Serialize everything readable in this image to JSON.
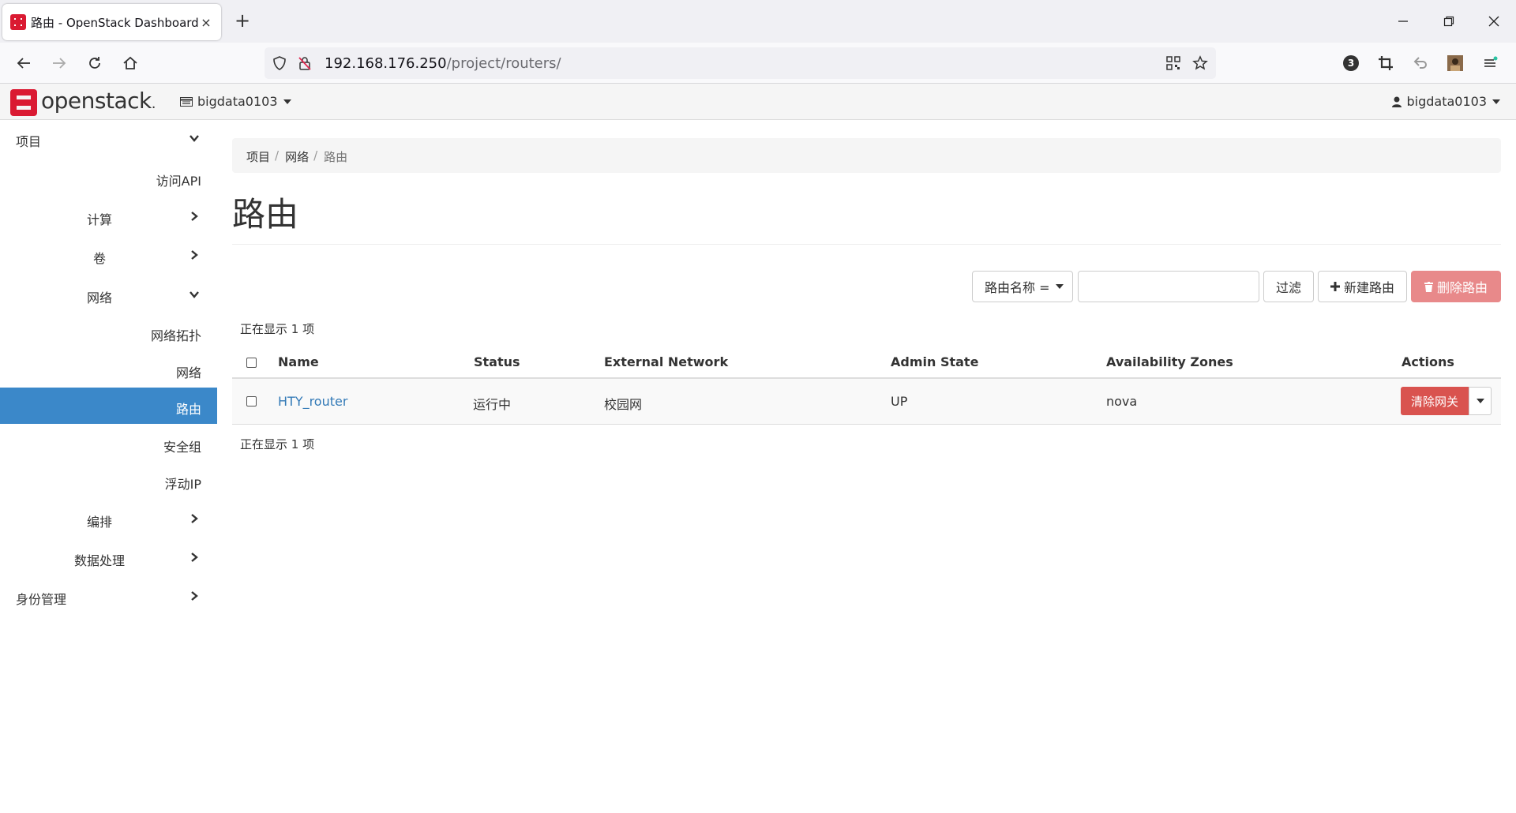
{
  "browser": {
    "tab_title": "路由 - OpenStack Dashboard",
    "tab_close": "×",
    "new_tab": "+",
    "url_host": "192.168.176.250",
    "url_path": "/project/routers/",
    "badge_count": "3"
  },
  "header": {
    "logo_text": "openstack",
    "logo_dot": ".",
    "project": "bigdata0103",
    "user": "bigdata0103",
    "brand_color": "#da1a32"
  },
  "sidebar": {
    "items": [
      {
        "label": "项目",
        "chevron": "down"
      },
      {
        "label": "访问API"
      },
      {
        "label": "计算",
        "chevron": "right"
      },
      {
        "label": "卷",
        "chevron": "right"
      },
      {
        "label": "网络",
        "chevron": "down"
      },
      {
        "label": "网络拓扑"
      },
      {
        "label": "网络"
      },
      {
        "label": "路由",
        "active": true
      },
      {
        "label": "安全组"
      },
      {
        "label": "浮动IP"
      },
      {
        "label": "编排",
        "chevron": "right"
      },
      {
        "label": "数据处理",
        "chevron": "right"
      },
      {
        "label": "身份管理",
        "chevron": "right"
      }
    ],
    "active_color": "#3b88c9"
  },
  "breadcrumb": [
    "项目",
    "网络",
    "路由"
  ],
  "page_title": "路由",
  "toolbar": {
    "filter_field": "路由名称 =",
    "filter_value": "",
    "filter_button": "过滤",
    "create_button": "新建路由",
    "delete_button": "删除路由"
  },
  "table": {
    "count_top": "正在显示 1 项",
    "count_bottom": "正在显示 1 项",
    "columns": [
      "Name",
      "Status",
      "External Network",
      "Admin State",
      "Availability Zones",
      "Actions"
    ],
    "rows": [
      {
        "name": "HTY_router",
        "status": "运行中",
        "external_network": "校园网",
        "admin_state": "UP",
        "zones": "nova",
        "action": "清除网关"
      }
    ]
  }
}
